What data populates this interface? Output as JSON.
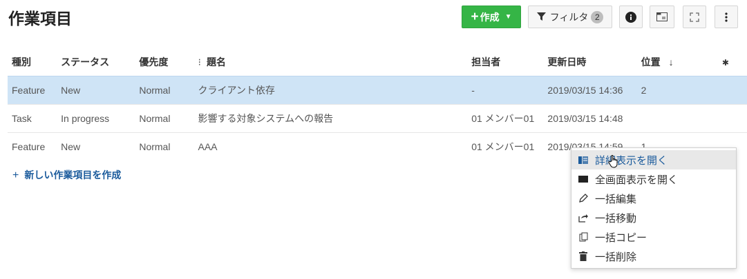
{
  "page": {
    "title": "作業項目"
  },
  "toolbar": {
    "create_label": "作成",
    "filter_label": "フィルタ",
    "filter_count": "2"
  },
  "table": {
    "columns": [
      "種別",
      "ステータス",
      "優先度",
      "題名",
      "担当者",
      "更新日時",
      "位置"
    ],
    "rows": [
      {
        "type": "Feature",
        "status": "New",
        "priority": "Normal",
        "subject": "クライアント依存",
        "assignee": "-",
        "updated": "2019/03/15 14:36",
        "position": "2"
      },
      {
        "type": "Task",
        "status": "In progress",
        "priority": "Normal",
        "subject": "影響する対象システムへの報告",
        "assignee": "01 メンバー01",
        "updated": "2019/03/15 14:48",
        "position": ""
      },
      {
        "type": "Feature",
        "status": "New",
        "priority": "Normal",
        "subject": "AAA",
        "assignee": "01 メンバー01",
        "updated": "2019/03/15 14:59",
        "position": "1"
      }
    ]
  },
  "new_item_label": "新しい作業項目を作成",
  "context_menu": {
    "items": [
      {
        "label": "詳細表示を開く",
        "icon": "split-view-icon"
      },
      {
        "label": "全画面表示を開く",
        "icon": "fullscreen-view-icon"
      },
      {
        "label": "一括編集",
        "icon": "pencil-icon"
      },
      {
        "label": "一括移動",
        "icon": "move-icon"
      },
      {
        "label": "一括コピー",
        "icon": "copy-icon"
      },
      {
        "label": "一括削除",
        "icon": "trash-icon"
      }
    ]
  },
  "colors": {
    "create_button": "#35b546",
    "selected_row": "#cfe4f6",
    "link": "#1b5b9c"
  }
}
